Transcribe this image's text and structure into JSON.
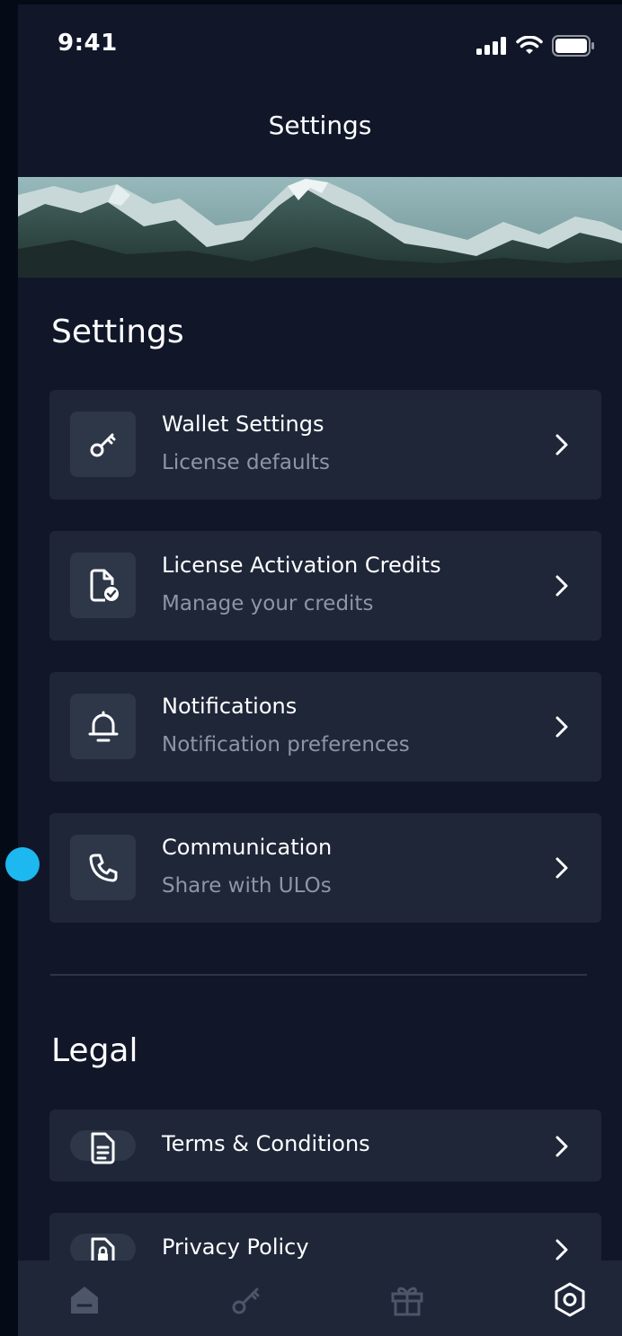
{
  "status_bar": {
    "time": "9:41"
  },
  "header": {
    "title": "Settings"
  },
  "sections": {
    "settings_heading": "Settings",
    "legal_heading": "Legal"
  },
  "settings_items": [
    {
      "title": "Wallet Settings",
      "subtitle": "License defaults",
      "icon": "key-icon"
    },
    {
      "title": "License Activation Credits",
      "subtitle": "Manage your credits",
      "icon": "document-check-icon"
    },
    {
      "title": "Notifications",
      "subtitle": "Notification preferences",
      "icon": "bell-icon"
    },
    {
      "title": "Communication",
      "subtitle": "Share with ULOs",
      "icon": "phone-icon"
    }
  ],
  "legal_items": [
    {
      "title": "Terms & Conditions",
      "icon": "document-icon"
    },
    {
      "title": "Privacy Policy",
      "icon": "document-lock-icon"
    }
  ],
  "tab_bar": {
    "tabs": [
      {
        "name": "home",
        "icon": "home-icon",
        "active": false
      },
      {
        "name": "licenses",
        "icon": "key-icon",
        "active": false
      },
      {
        "name": "rewards",
        "icon": "gift-icon",
        "active": false
      },
      {
        "name": "settings",
        "icon": "settings-hex-icon",
        "active": true
      }
    ]
  },
  "colors": {
    "background": "#111729",
    "card": "#1e2638",
    "icon_box": "#2e3748",
    "subtitle": "#8c96a6",
    "tab_inactive": "#4c5668",
    "accent_dot": "#1cb8ef"
  }
}
